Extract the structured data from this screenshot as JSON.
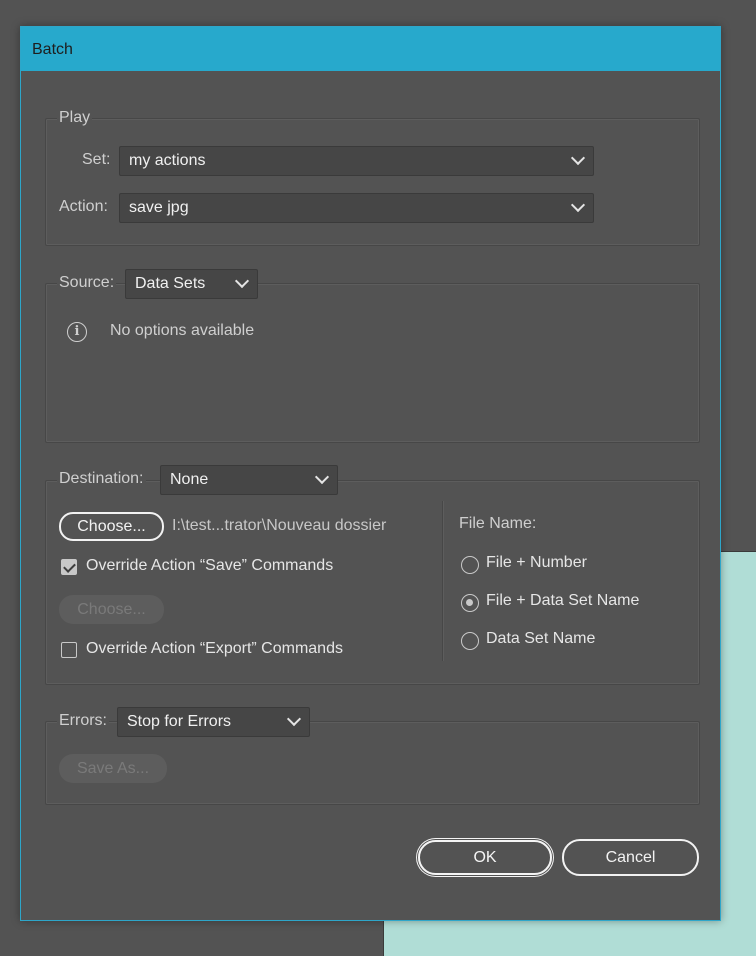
{
  "window": {
    "title": "Batch"
  },
  "play": {
    "group_label": "Play",
    "set_label": "Set:",
    "set_value": "my actions",
    "action_label": "Action:",
    "action_value": "save jpg"
  },
  "source": {
    "label": "Source:",
    "value": "Data Sets",
    "info_text": "No options available"
  },
  "destination": {
    "label": "Destination:",
    "value": "None",
    "choose_label": "Choose...",
    "path": "I:\\test...trator\\Nouveau dossier",
    "override_save_label": "Override Action “Save” Commands",
    "override_save_checked": true,
    "choose_disabled_label": "Choose...",
    "override_export_label": "Override Action “Export” Commands",
    "override_export_checked": false
  },
  "file_name": {
    "label": "File Name:",
    "options": [
      {
        "label": "File + Number",
        "selected": false
      },
      {
        "label": "File + Data Set Name",
        "selected": true
      },
      {
        "label": "Data Set Name",
        "selected": false
      }
    ]
  },
  "errors": {
    "label": "Errors:",
    "value": "Stop for Errors",
    "save_as_label": "Save As..."
  },
  "buttons": {
    "ok": "OK",
    "cancel": "Cancel"
  },
  "colors": {
    "titlebar": "#27a9cc",
    "panel": "#535353",
    "background_right": "#b0ddd6"
  },
  "icons": {
    "info": "info-icon",
    "dropdown": "chevron-down-icon"
  }
}
